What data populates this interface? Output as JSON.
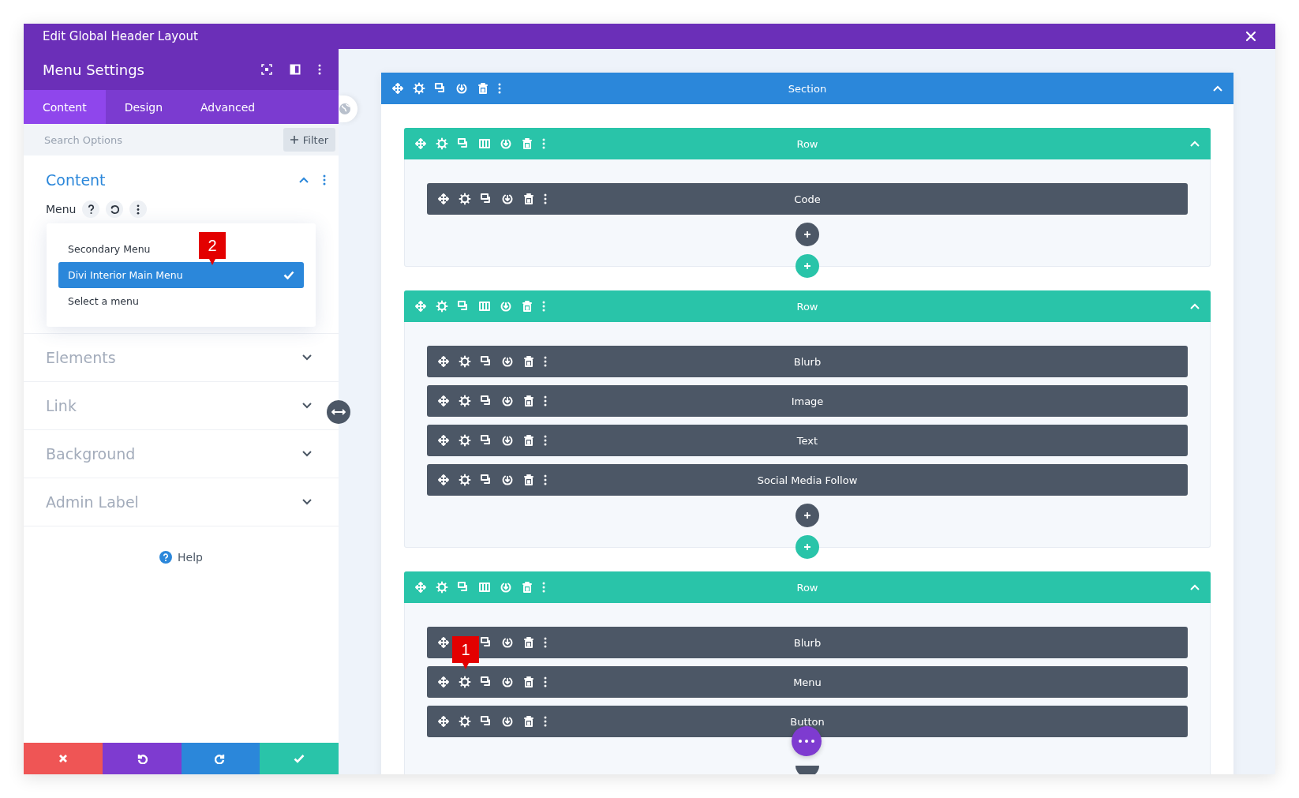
{
  "window": {
    "title": "Edit Global Header Layout"
  },
  "settings_panel": {
    "title": "Menu Settings",
    "tabs": [
      {
        "label": "Content",
        "selected": true
      },
      {
        "label": "Design",
        "selected": false
      },
      {
        "label": "Advanced",
        "selected": false
      }
    ],
    "search": {
      "placeholder": "Search Options"
    },
    "filter_button": "Filter",
    "groups": [
      {
        "title": "Content",
        "expanded": true,
        "field": {
          "label": "Menu",
          "options": [
            {
              "label": "Secondary Menu",
              "selected": false
            },
            {
              "label": "Divi Interior Main Menu",
              "selected": true,
              "callout": "2"
            },
            {
              "label": "Select a menu",
              "selected": false
            }
          ]
        }
      },
      {
        "title": "Elements",
        "expanded": false
      },
      {
        "title": "Link",
        "expanded": false
      },
      {
        "title": "Background",
        "expanded": false
      },
      {
        "title": "Admin Label",
        "expanded": false
      }
    ],
    "help": "Help"
  },
  "canvas": {
    "section": {
      "label": "Section",
      "rows": [
        {
          "label": "Row",
          "modules": [
            {
              "label": "Code"
            }
          ]
        },
        {
          "label": "Row",
          "modules": [
            {
              "label": "Blurb"
            },
            {
              "label": "Image"
            },
            {
              "label": "Text"
            },
            {
              "label": "Social Media Follow"
            }
          ]
        },
        {
          "label": "Row",
          "modules": [
            {
              "label": "Blurb"
            },
            {
              "label": "Menu",
              "callout": "1"
            },
            {
              "label": "Button"
            }
          ]
        }
      ]
    }
  }
}
